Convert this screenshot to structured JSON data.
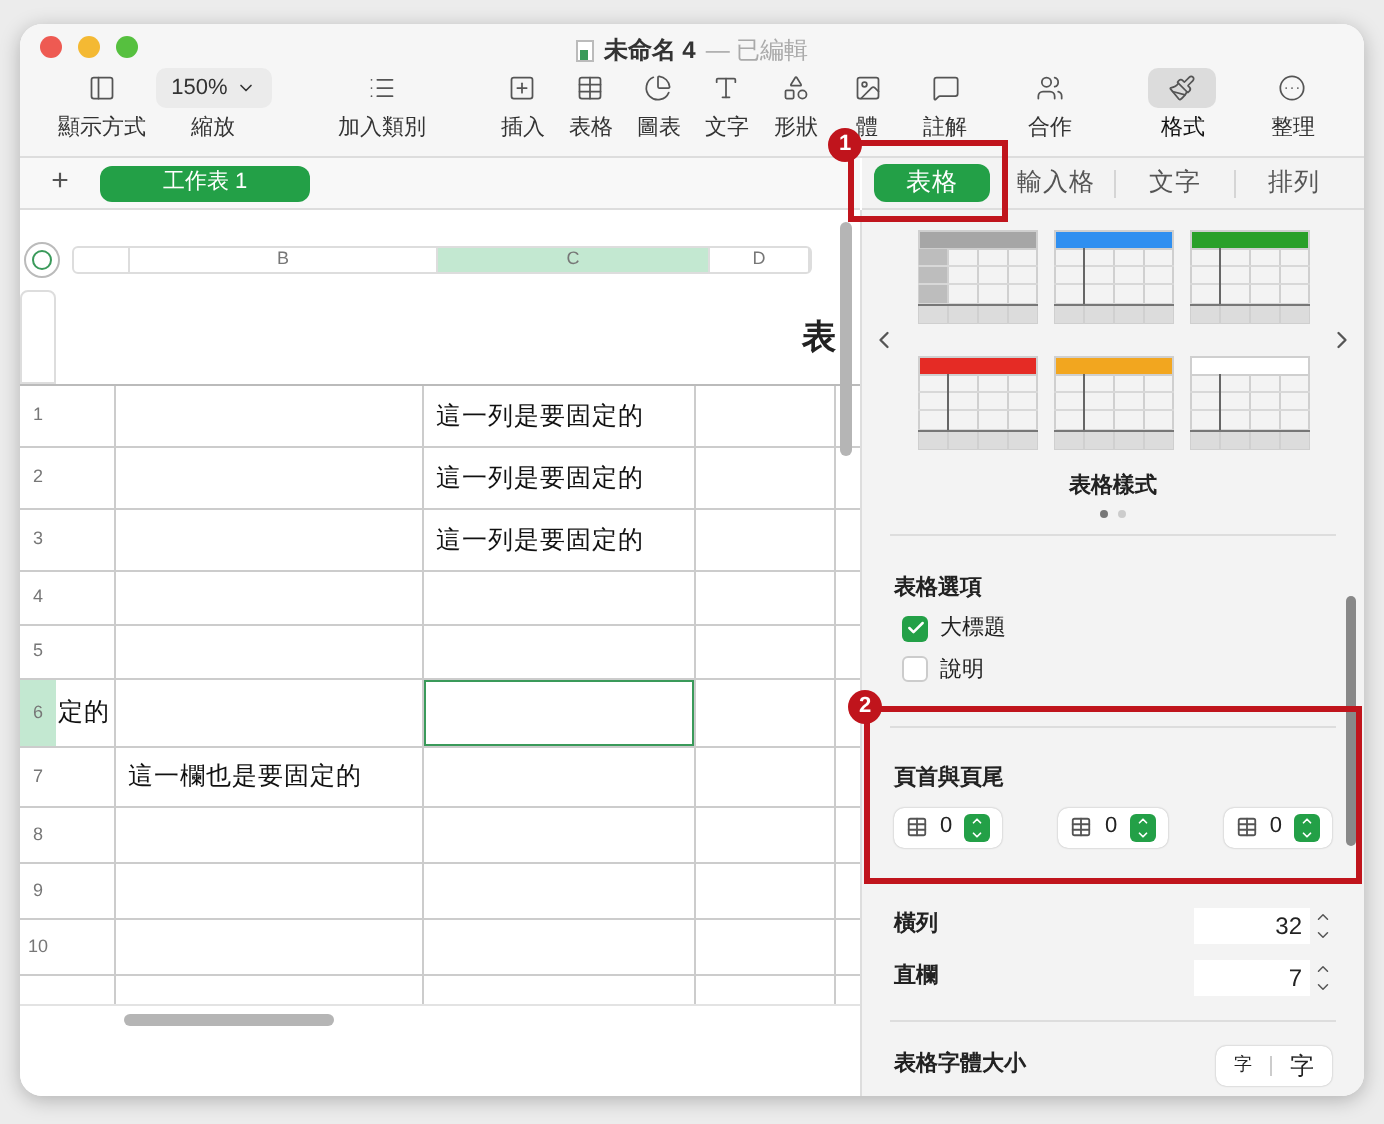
{
  "window": {
    "title": "未命名 4",
    "status": "— 已編輯"
  },
  "toolbar": [
    {
      "label": "顯示方式",
      "selected": false
    },
    {
      "label": "縮放",
      "value": "150%"
    },
    {
      "label": "加入類別",
      "selected": false
    },
    {
      "label": "插入",
      "selected": false
    },
    {
      "label": "表格",
      "selected": false
    },
    {
      "label": "圖表",
      "selected": false
    },
    {
      "label": "文字",
      "selected": false
    },
    {
      "label": "形狀",
      "selected": false
    },
    {
      "label": "體",
      "selected": false
    },
    {
      "label": "註解",
      "selected": false
    },
    {
      "label": "合作",
      "selected": false
    },
    {
      "label": "格式",
      "selected": true
    },
    {
      "label": "整理",
      "selected": false
    }
  ],
  "sheet_tabs": {
    "add": "+",
    "tabs": [
      {
        "label": "工作表 1",
        "selected": true
      }
    ]
  },
  "inspector_tabs": [
    {
      "label": "表格",
      "selected": true
    },
    {
      "label": "輸入格",
      "selected": false
    },
    {
      "label": "文字",
      "selected": false
    },
    {
      "label": "排列",
      "selected": false
    }
  ],
  "sheet": {
    "columns": [
      {
        "label": "B",
        "selected": false
      },
      {
        "label": "C",
        "selected": true
      },
      {
        "label": "D",
        "selected": false
      }
    ],
    "title": "表",
    "rows": [
      {
        "number": "1",
        "selected": false,
        "col_c": "這一列是要固定的"
      },
      {
        "number": "2",
        "selected": false,
        "col_c": "這一列是要固定的"
      },
      {
        "number": "3",
        "selected": false,
        "col_c": "這一列是要固定的"
      },
      {
        "number": "4",
        "selected": false
      },
      {
        "number": "5",
        "selected": false
      },
      {
        "number": "6",
        "selected": true,
        "col_a": "定的"
      },
      {
        "number": "7",
        "selected": false,
        "col_b": "這一欄也是要固定的"
      },
      {
        "number": "8",
        "selected": false
      },
      {
        "number": "9",
        "selected": false
      },
      {
        "number": "10",
        "selected": false
      }
    ]
  },
  "table_styles": {
    "label": "表格樣式",
    "styles": [
      {
        "kind": "header-column",
        "color": "#a6a6a6"
      },
      {
        "kind": "header",
        "color": "#2f8ff0"
      },
      {
        "kind": "header",
        "color": "#2aa02a"
      },
      {
        "kind": "header",
        "color": "#e52b25"
      },
      {
        "kind": "header",
        "color": "#f2a61f"
      },
      {
        "kind": "header",
        "color": "#ffffff"
      }
    ],
    "pages": [
      {
        "selected": true
      },
      {
        "selected": false
      }
    ]
  },
  "table_options": {
    "title": "表格選項",
    "items": [
      {
        "label": "大標題",
        "checked": true
      },
      {
        "label": "說明",
        "checked": false
      }
    ]
  },
  "header_footer": {
    "title": "頁首與頁尾",
    "steppers": [
      {
        "value": "0"
      },
      {
        "value": "0"
      },
      {
        "value": "0"
      }
    ]
  },
  "rows_field": {
    "label": "橫列",
    "value": "32"
  },
  "columns_field": {
    "label": "直欄",
    "value": "7"
  },
  "font_size": {
    "label": "表格字體大小",
    "buttons": [
      "字",
      "字"
    ]
  },
  "callouts": [
    {
      "number": "1"
    },
    {
      "number": "2"
    }
  ]
}
